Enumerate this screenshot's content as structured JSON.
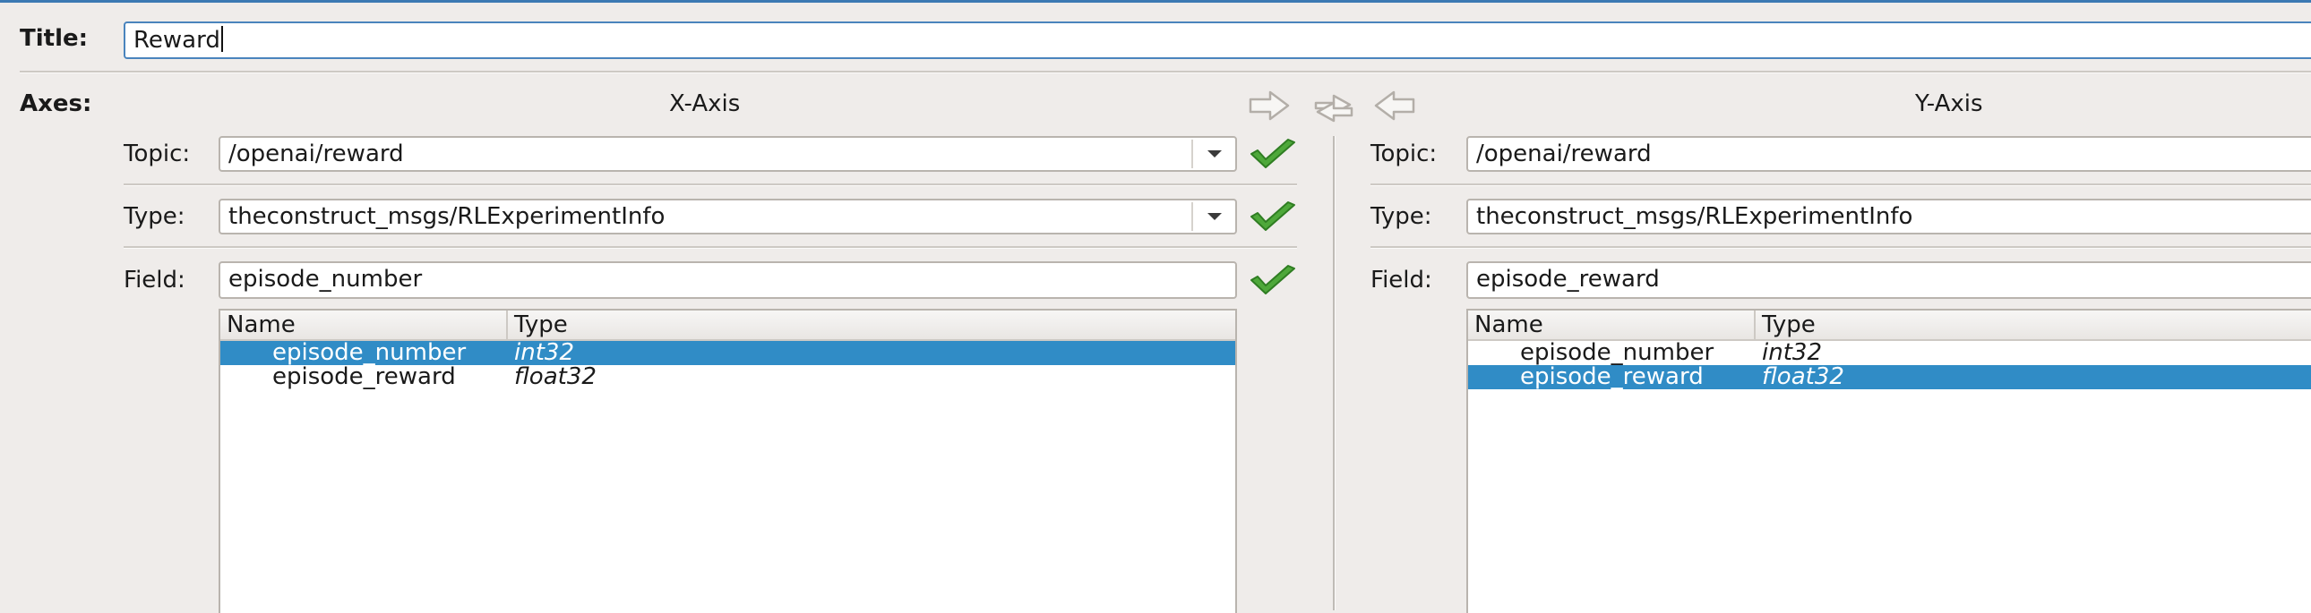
{
  "window": {
    "accent_color": "#3c79b3",
    "selection_color": "#308cc6",
    "ok_color": "#4ea83a"
  },
  "title": {
    "label": "Title:",
    "value": "Reward"
  },
  "axes": {
    "label": "Axes:",
    "transfer_icons": [
      "copy-right-arrow-icon",
      "swap-arrows-icon",
      "copy-left-arrow-icon"
    ],
    "x": {
      "header": "X-Axis",
      "topic": {
        "label": "Topic:",
        "value": "/openai/reward",
        "status": "check-icon"
      },
      "type": {
        "label": "Type:",
        "value": "theconstruct_msgs/RLExperimentInfo",
        "status": "check-icon"
      },
      "field": {
        "label": "Field:",
        "value": "episode_number",
        "status": "check-icon"
      },
      "table": {
        "columns": [
          "Name",
          "Type"
        ],
        "rows": [
          {
            "name": "episode_number",
            "type": "int32",
            "selected": true
          },
          {
            "name": "episode_reward",
            "type": "float32",
            "selected": false
          }
        ]
      }
    },
    "y": {
      "header": "Y-Axis",
      "topic": {
        "label": "Topic:",
        "value": "/openai/reward"
      },
      "type": {
        "label": "Type:",
        "value": "theconstruct_msgs/RLExperimentInfo"
      },
      "field": {
        "label": "Field:",
        "value": "episode_reward"
      },
      "table": {
        "columns": [
          "Name",
          "Type"
        ],
        "rows": [
          {
            "name": "episode_number",
            "type": "int32",
            "selected": false
          },
          {
            "name": "episode_reward",
            "type": "float32",
            "selected": true
          }
        ]
      }
    }
  }
}
